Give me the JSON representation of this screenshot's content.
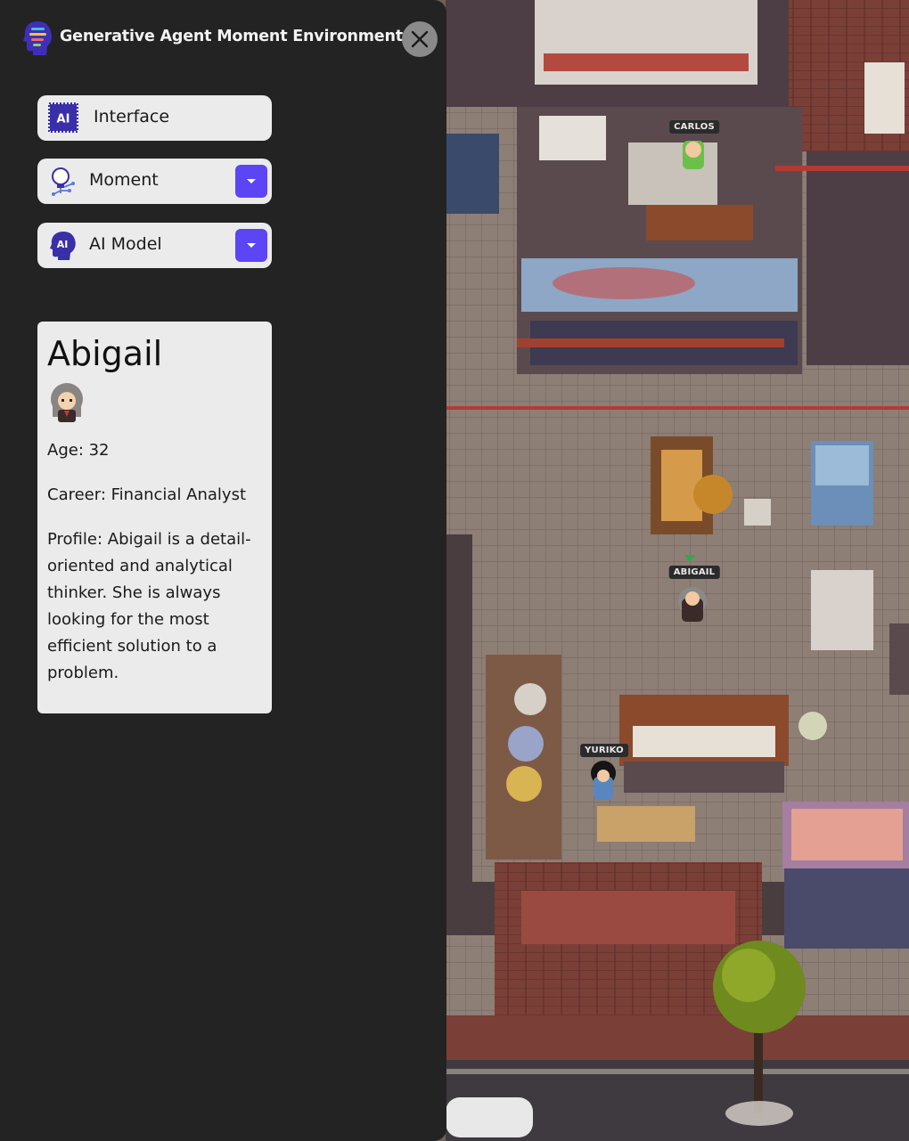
{
  "app": {
    "title": "Generative Agent Moment Environment",
    "logo_icon": "ai-head-logo-icon",
    "close_icon": "close-icon"
  },
  "menu": [
    {
      "label": "Interface",
      "icon": "ai-chip-icon",
      "has_dropdown": false
    },
    {
      "label": "Moment",
      "icon": "lightbulb-circuit-icon",
      "has_dropdown": true
    },
    {
      "label": "AI Model",
      "icon": "ai-head-icon",
      "has_dropdown": true
    }
  ],
  "accent_color": "#5b45f5",
  "character": {
    "name": "Abigail",
    "age_line": "Age: 32",
    "career_line": "Career: Financial Analyst",
    "profile_line": "Profile: Abigail is a detail-oriented and analytical thinker. She is always looking for the most efficient solution to a problem."
  },
  "map": {
    "agents": [
      {
        "name": "CARLOS"
      },
      {
        "name": "ABIGAIL"
      },
      {
        "name": "YURIKO"
      }
    ]
  }
}
